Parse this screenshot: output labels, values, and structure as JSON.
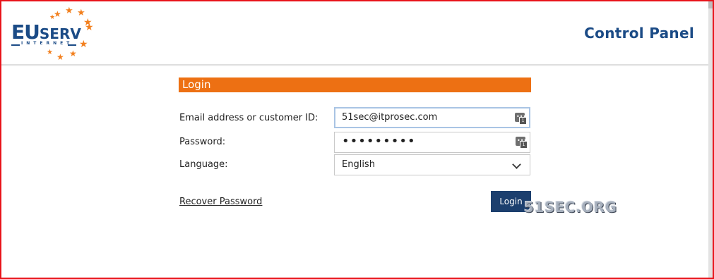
{
  "header": {
    "logo": {
      "main": "EU",
      "secondary": "SERV",
      "sub": "INTERNET"
    },
    "title": "Control Panel"
  },
  "login": {
    "section_title": "Login",
    "email_label": "Email address or customer ID:",
    "email_value": "51sec@itprosec.com",
    "password_label": "Password:",
    "password_value": "•••••••••",
    "language_label": "Language:",
    "language_value": "English",
    "recover_link": "Recover Password",
    "login_button": "Login"
  },
  "watermark": "51SEC.ORG",
  "colors": {
    "brand_blue": "#1b4b86",
    "accent_orange": "#ed7013",
    "button_navy": "#1c3f6e",
    "frame_red": "#e8141b"
  },
  "icons": [
    "star-icon",
    "password-manager-icon",
    "chevron-down-icon"
  ]
}
